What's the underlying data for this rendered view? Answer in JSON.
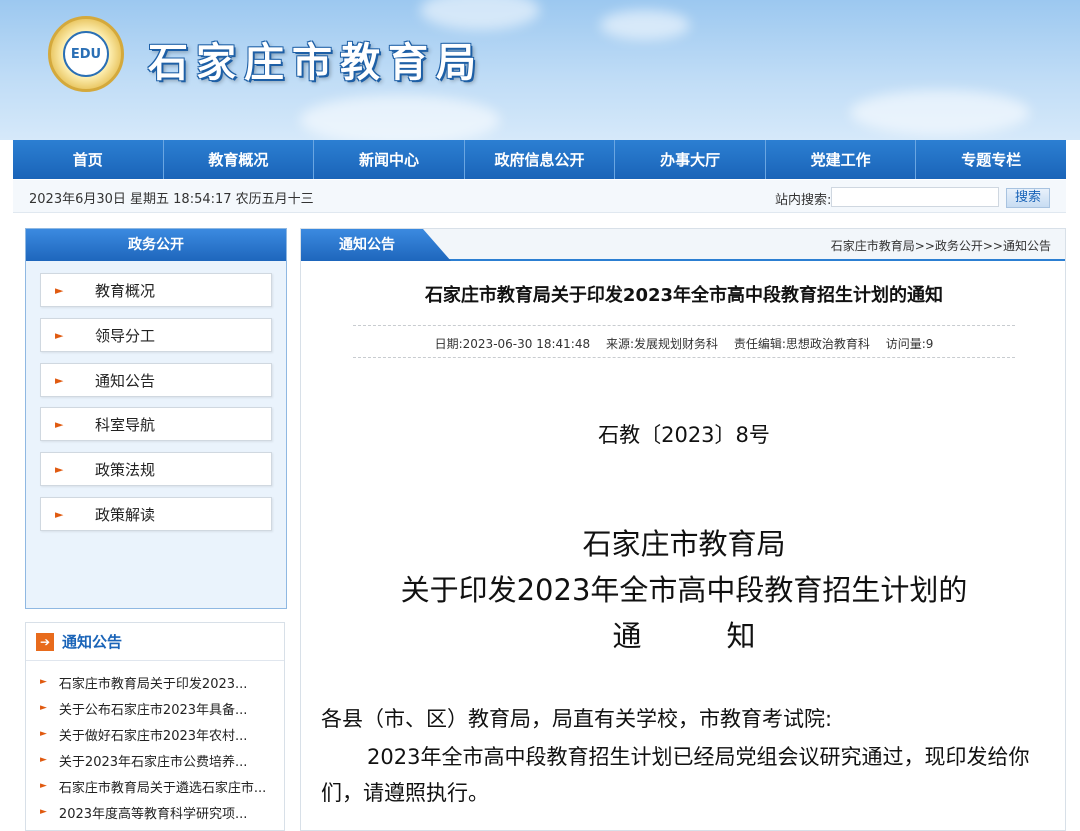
{
  "header": {
    "site_title": "石家庄市教育局",
    "logo_text": "EDU",
    "logo_icon": "edu-emblem-icon"
  },
  "nav": {
    "items": [
      "首页",
      "教育概况",
      "新闻中心",
      "政府信息公开",
      "办事大厅",
      "党建工作",
      "专题专栏"
    ]
  },
  "topbar": {
    "datetime": "2023年6月30日 星期五 18:54:17 农历五月十三",
    "search_label": "站内搜索:",
    "search_placeholder": "",
    "search_button": "搜索"
  },
  "sidebar": {
    "title": "政务公开",
    "items": [
      "教育概况",
      "领导分工",
      "通知公告",
      "科室导航",
      "政策法规",
      "政策解读"
    ]
  },
  "notices": {
    "title": "通知公告",
    "items": [
      "石家庄市教育局关于印发2023...",
      "关于公布石家庄市2023年具备...",
      "关于做好石家庄市2023年农村...",
      "关于2023年石家庄市公费培养...",
      "石家庄市教育局关于遴选石家庄市...",
      "2023年度高等教育科学研究项..."
    ]
  },
  "content": {
    "tab_label": "通知公告",
    "breadcrumb": "石家庄市教育局>>政务公开>>通知公告",
    "title": "石家庄市教育局关于印发2023年全市高中段教育招生计划的通知",
    "meta": {
      "date": "日期:2023-06-30 18:41:48",
      "source": "来源:发展规划财务科",
      "editor": "责任编辑:思想政治教育科",
      "views": "访问量:9"
    },
    "doc_number": "石教〔2023〕8号",
    "doc_title_line1": "石家庄市教育局",
    "doc_title_line2": "关于印发2023年全市高中段教育招生计划的",
    "doc_title_line3a": "通",
    "doc_title_line3b": "知",
    "salutation": "各县（市、区）教育局，局直有关学校，市教育考试院:",
    "paragraph1": "2023年全市高中段教育招生计划已经局党组会议研究通过，现印发给你们，请遵照执行。"
  },
  "colors": {
    "nav_blue": "#1a64b8",
    "accent_orange": "#e05a10"
  }
}
